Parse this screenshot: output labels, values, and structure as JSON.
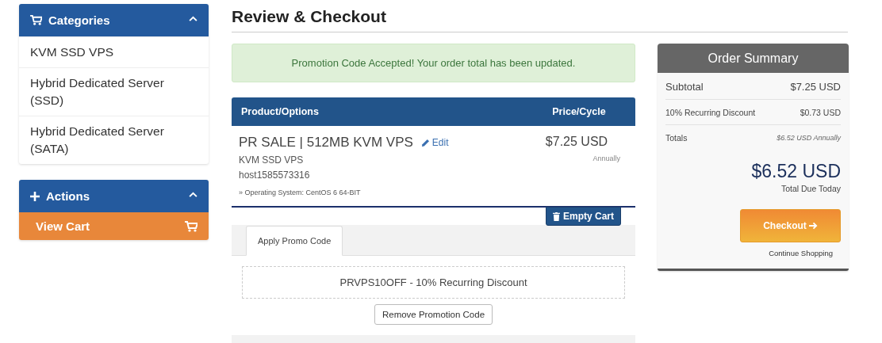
{
  "sidebar": {
    "panels": [
      {
        "kind": "categories",
        "title": "Categories",
        "expanded": true,
        "items": [
          {
            "label": "KVM SSD VPS"
          },
          {
            "label": "Hybrid Dedicated Server (SSD)"
          },
          {
            "label": "Hybrid Dedicated Server (SATA)"
          }
        ]
      },
      {
        "kind": "actions",
        "title": "Actions",
        "expanded": true,
        "items": [
          {
            "label": "View Cart"
          }
        ]
      }
    ]
  },
  "page_title": "Review & Checkout",
  "alert": "Promotion Code Accepted! Your order total has been updated.",
  "cart": {
    "columns": [
      "Product/Options",
      "Price/Cycle"
    ],
    "item": {
      "name": "PR SALE | 512MB KVM VPS",
      "edit": "Edit",
      "group": "KVM SSD VPS",
      "hostname": "host1585573316",
      "option": "» Operating System: CentOS 6 64-BIT",
      "price": "$7.25 USD",
      "cycle": "Annually"
    },
    "empty_button": "Empty Cart"
  },
  "promo": {
    "tabs": [
      {
        "label": "Apply Promo Code",
        "selected": true
      }
    ],
    "applied": "PRVPS10OFF - 10% Recurring Discount",
    "remove_button": "Remove Promotion Code"
  },
  "summary": {
    "title": "Order Summary",
    "lines": [
      {
        "label": "Subtotal",
        "value": "$7.25 USD",
        "kind": "main"
      },
      {
        "label": "10% Recurring Discount",
        "value": "$0.73 USD",
        "kind": "minor"
      },
      {
        "label": "Totals",
        "value": "$6.52 USD Annually",
        "kind": "note"
      }
    ],
    "total": "$6.52 USD",
    "total_caption": "Total Due Today",
    "checkout": "Checkout",
    "continue": "Continue Shopping"
  }
}
